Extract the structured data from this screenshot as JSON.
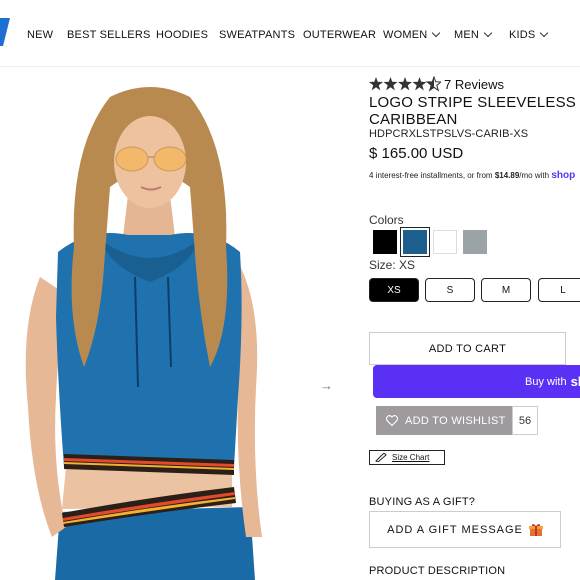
{
  "nav": {
    "items": [
      {
        "label": "NEW",
        "dropdown": false
      },
      {
        "label": "BEST SELLERS",
        "dropdown": false
      },
      {
        "label": "HOODIES",
        "dropdown": false
      },
      {
        "label": "SWEATPANTS",
        "dropdown": false
      },
      {
        "label": "OUTERWEAR",
        "dropdown": false
      },
      {
        "label": "WOMEN",
        "dropdown": true
      },
      {
        "label": "MEN",
        "dropdown": true
      },
      {
        "label": "KIDS",
        "dropdown": true
      }
    ]
  },
  "product": {
    "rating": 4.5,
    "reviews_label": "7 Reviews",
    "title_line1": "LOGO STRIPE SLEEVELESS CROP HOODIE - VINTAGE",
    "title_line2": "CARIBBEAN",
    "sku": "HDPCRXLSTPSLVS-CARIB-XS",
    "price": "$ 165.00 USD",
    "installments": {
      "prefix": "4 interest-free installments, or from ",
      "amount": "$14.89",
      "suffix": "/mo with ",
      "brand": "shop"
    },
    "colors_label": "Colors",
    "colors": [
      {
        "name": "Black",
        "hex": "#000000",
        "selected": false
      },
      {
        "name": "Vintage Caribbean",
        "hex": "#1c5e8c",
        "selected": true
      },
      {
        "name": "White",
        "hex": "#ffffff",
        "selected": false
      },
      {
        "name": "Grey",
        "hex": "#9aa3a6",
        "selected": false
      }
    ],
    "size_label": "Size: XS",
    "sizes": [
      {
        "label": "XS",
        "selected": true
      },
      {
        "label": "S",
        "selected": false
      },
      {
        "label": "M",
        "selected": false
      },
      {
        "label": "L",
        "selected": false
      }
    ],
    "add_to_cart": "ADD TO CART",
    "buy_with": "Buy with",
    "buy_with_brand": "shop",
    "wishlist_label": "ADD TO WISHLIST",
    "wishlist_count": "56",
    "size_chart": "Size Chart",
    "gift_question": "BUYING AS A GIFT?",
    "gift_button": "ADD A GIFT MESSAGE",
    "description_heading": "PRODUCT DESCRIPTION"
  },
  "colors": {
    "shop_purple": "#5a31f4",
    "wishlist_grey": "#9e9a9e",
    "hoodie_blue": "#1f72ad",
    "logo_blue": "#1d6fd1"
  },
  "icons": [
    "logo-mark",
    "star-icon",
    "chevron-down-icon",
    "next-arrow-icon",
    "heart-icon",
    "ruler-icon",
    "gift-icon"
  ]
}
